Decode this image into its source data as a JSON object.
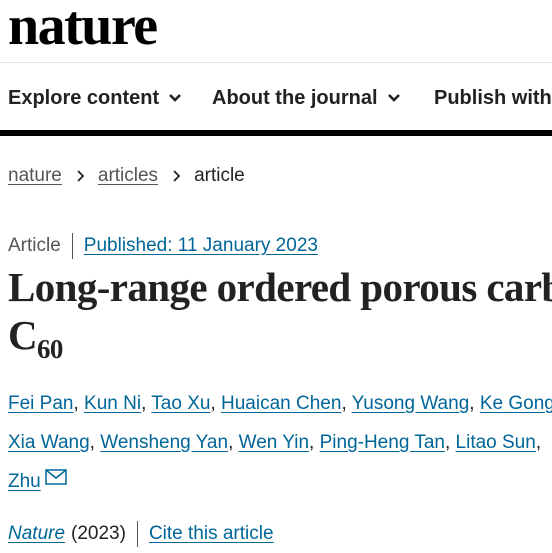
{
  "site": {
    "logo": "nature"
  },
  "nav": {
    "items": [
      {
        "label": "Explore content"
      },
      {
        "label": "About the journal"
      },
      {
        "label": "Publish with"
      }
    ]
  },
  "breadcrumb": {
    "items": [
      "nature",
      "articles",
      "article"
    ]
  },
  "article": {
    "type": "Article",
    "published": "Published: 11 January 2023",
    "title_line1": "Long-range ordered porous carb",
    "title_line2_main": "C",
    "title_line2_sub": "60",
    "authors_line1": [
      "Fei Pan",
      "Kun Ni",
      "Tao Xu",
      "Huaican Chen",
      "Yusong Wang",
      "Ke Gong"
    ],
    "authors_line2": [
      "Xia Wang",
      "Wensheng Yan",
      "Wen Yin",
      "Ping-Heng Tan",
      "Litao Sun"
    ],
    "authors_line3": [
      "Zhu"
    ],
    "separator": ",",
    "journal_name": "Nature",
    "journal_year": "(2023)",
    "cite_label": "Cite this article"
  },
  "icons": {
    "chevron": "chevron-down-icon",
    "crumb": "chevron-right-icon",
    "mail": "mail-icon"
  },
  "colors": {
    "link": "#006699",
    "text": "#222222",
    "muted": "#555555"
  }
}
